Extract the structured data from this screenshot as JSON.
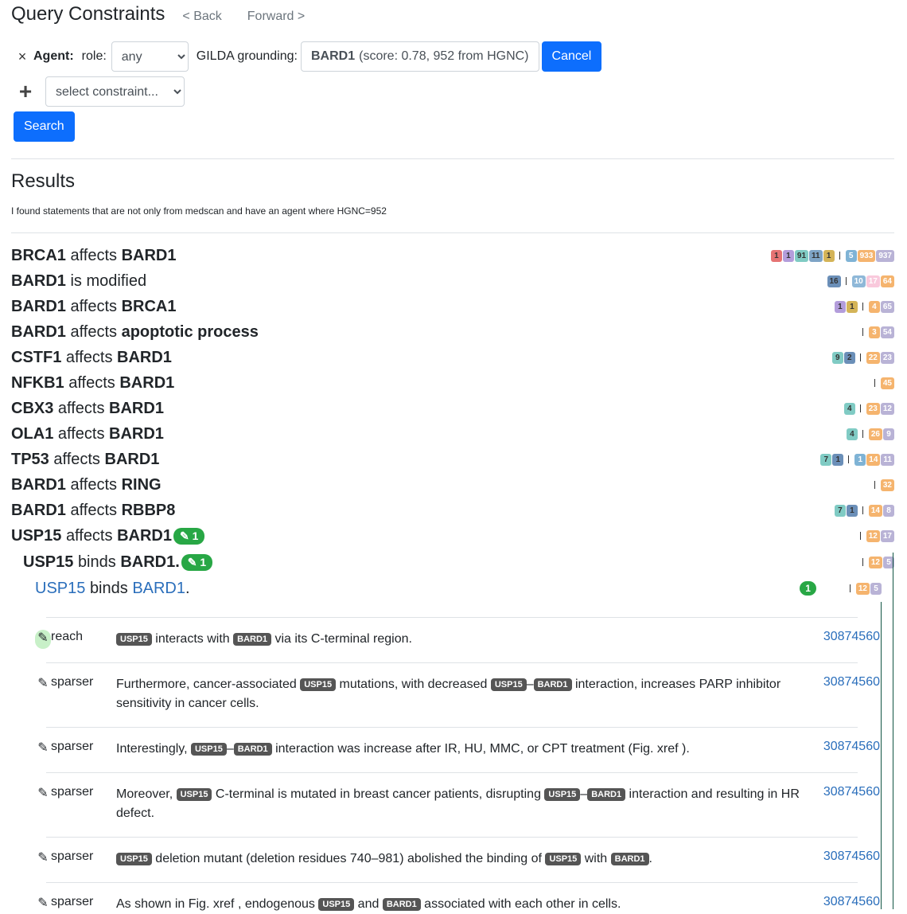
{
  "header": {
    "title": "Query Constraints",
    "back": "< Back",
    "forward": "Forward >"
  },
  "constraint": {
    "close": "×",
    "agent_label": "Agent:",
    "role_label": "role:",
    "role_value": "any",
    "gilda_label": "GILDA grounding:",
    "gilda_name": "BARD1",
    "gilda_detail": "(score: 0.78, 952 from HGNC)",
    "cancel": "Cancel"
  },
  "add": {
    "plus": "+",
    "select_placeholder": "select constraint..."
  },
  "search_button": "Search",
  "results": {
    "heading": "Results",
    "summary": "I found statements that are not only from medscan and have an agent where HGNC=952"
  },
  "statements": [
    {
      "subj": "BRCA1",
      "verb": "affects",
      "obj": "BARD1",
      "badges": [
        [
          "1",
          "#e57373"
        ],
        [
          "1",
          "#b39ddb"
        ],
        [
          "91",
          "#80cbc4"
        ],
        [
          "11",
          "#7ea4c6"
        ],
        [
          "1",
          "#d4b458"
        ],
        "|",
        [
          "5",
          "#7fb3d5"
        ],
        [
          "933",
          "#f5b46e"
        ],
        [
          "937",
          "#b9b3d6"
        ]
      ]
    },
    {
      "subj": "BARD1",
      "verb": "is modified",
      "obj": "",
      "badges": [
        [
          "16",
          "#6b8fb8"
        ],
        "|",
        [
          "10",
          "#8fb8d8"
        ],
        [
          "17",
          "#f9c9dc"
        ],
        [
          "64",
          "#f5b46e"
        ]
      ]
    },
    {
      "subj": "BARD1",
      "verb": "affects",
      "obj": "BRCA1",
      "badges": [
        [
          "1",
          "#b39ddb"
        ],
        [
          "1",
          "#d4b458"
        ],
        "|",
        [
          "4",
          "#f5b46e"
        ],
        [
          "65",
          "#b9b3d6"
        ]
      ]
    },
    {
      "subj": "BARD1",
      "verb": "affects",
      "obj": "apoptotic process",
      "badges": [
        "|",
        [
          "3",
          "#f5b46e"
        ],
        [
          "54",
          "#b9b3d6"
        ]
      ]
    },
    {
      "subj": "CSTF1",
      "verb": "affects",
      "obj": "BARD1",
      "badges": [
        [
          "9",
          "#80cbc4"
        ],
        [
          "2",
          "#6b8fb8"
        ],
        "|",
        [
          "22",
          "#f5b46e"
        ],
        [
          "23",
          "#b9b3d6"
        ]
      ]
    },
    {
      "subj": "NFKB1",
      "verb": "affects",
      "obj": "BARD1",
      "badges": [
        "|",
        [
          "45",
          "#f5b46e"
        ]
      ]
    },
    {
      "subj": "CBX3",
      "verb": "affects",
      "obj": "BARD1",
      "badges": [
        [
          "4",
          "#80cbc4"
        ],
        "|",
        [
          "23",
          "#f5b46e"
        ],
        [
          "12",
          "#b9b3d6"
        ]
      ]
    },
    {
      "subj": "OLA1",
      "verb": "affects",
      "obj": "BARD1",
      "badges": [
        [
          "4",
          "#80cbc4"
        ],
        "|",
        [
          "26",
          "#f5b46e"
        ],
        [
          "9",
          "#b9b3d6"
        ]
      ]
    },
    {
      "subj": "TP53",
      "verb": "affects",
      "obj": "BARD1",
      "badges": [
        [
          "7",
          "#80cbc4"
        ],
        [
          "1",
          "#6b8fb8"
        ],
        "|",
        [
          "1",
          "#7fb3d5"
        ],
        [
          "14",
          "#f5b46e"
        ],
        [
          "11",
          "#b9b3d6"
        ]
      ]
    },
    {
      "subj": "BARD1",
      "verb": "affects",
      "obj": "RING",
      "badges": [
        "|",
        [
          "32",
          "#f5b46e"
        ]
      ]
    },
    {
      "subj": "BARD1",
      "verb": "affects",
      "obj": "RBBP8",
      "badges": [
        [
          "7",
          "#80cbc4"
        ],
        [
          "1",
          "#6b8fb8"
        ],
        "|",
        [
          "14",
          "#f5b46e"
        ],
        [
          "8",
          "#b9b3d6"
        ]
      ]
    },
    {
      "subj": "USP15",
      "verb": "affects",
      "obj": "BARD1",
      "badges": [
        "|",
        [
          "12",
          "#f5b46e"
        ],
        [
          "17",
          "#b9b3d6"
        ]
      ]
    }
  ],
  "usp15_affects_curations": "✎ 1",
  "binds_row": {
    "subj": "USP15",
    "verb": "binds",
    "obj": "BARD1.",
    "curations": "✎ 1",
    "b1": "12",
    "b2": "5"
  },
  "binds_sub": {
    "subj": "USP15",
    "verb": "binds",
    "obj": "BARD1",
    "dot": ".",
    "count": "1",
    "b1": "12",
    "b2": "5"
  },
  "evidence": [
    {
      "pen": "✎",
      "source": "reach",
      "pmid": "30874560"
    },
    {
      "pen": "✎",
      "source": "sparser",
      "pmid": "30874560"
    },
    {
      "pen": "✎",
      "source": "sparser",
      "pmid": "30874560"
    },
    {
      "pen": "✎",
      "source": "sparser",
      "pmid": "30874560"
    },
    {
      "pen": "✎",
      "source": "sparser",
      "pmid": "30874560"
    },
    {
      "pen": "✎",
      "source": "sparser",
      "pmid": "30874560"
    }
  ],
  "ev_text": {
    "e0": {
      "t1": "USP15",
      "s1": " interacts with ",
      "t2": "BARD1",
      "s2": " via its C-terminal region."
    },
    "e1": {
      "s0": "Furthermore, cancer-associated ",
      "t1": "USP15",
      "s1": " mutations, with decreased ",
      "t2": "USP15",
      "dash": "–",
      "t3": "BARD1",
      "s2": " interaction, increases PARP inhibitor sensitivity in cancer cells."
    },
    "e2": {
      "s0": "Interestingly, ",
      "t1": "USP15",
      "dash": "–",
      "t2": "BARD1",
      "s1": " interaction was increase after IR, HU, MMC, or CPT treatment (Fig.  xref )."
    },
    "e3": {
      "s0": "Moreover, ",
      "t1": "USP15",
      "s1": " C-terminal is mutated in breast cancer patients, disrupting ",
      "t2": "USP15",
      "dash": "–",
      "t3": "BARD1",
      "s2": " interaction and resulting in HR defect."
    },
    "e4": {
      "t1": "USP15",
      "s1": " deletion mutant (deletion residues 740–981) abolished the binding of ",
      "t2": "USP15",
      "s2": " with ",
      "t3": "BARD1",
      "s3": "."
    },
    "e5": {
      "s0": "As shown in Fig.  xref , endogenous ",
      "t1": "USP15",
      "s1": " and ",
      "t2": "BARD1",
      "s2": " associated with each other in cells."
    }
  }
}
